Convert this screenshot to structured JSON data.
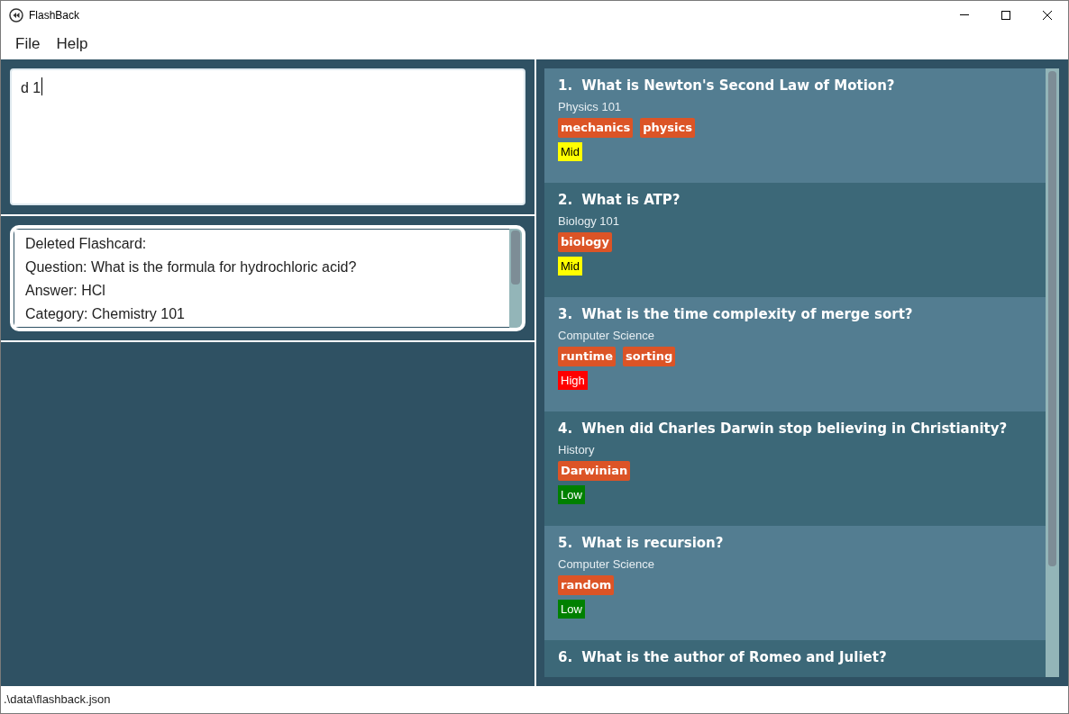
{
  "window": {
    "title": "FlashBack"
  },
  "menu": [
    "File",
    "Help"
  ],
  "command_box": {
    "value": "d 1"
  },
  "result_box": {
    "lines": [
      "Deleted Flashcard:",
      "Question: What is the formula for hydrochloric acid?",
      "Answer: HCl",
      "Category: Chemistry 101"
    ]
  },
  "flashcards": [
    {
      "index": "1.",
      "question": "What is Newton's Second Law of Motion?",
      "category": "Physics 101",
      "tags": [
        "mechanics",
        "physics"
      ],
      "difficulty": {
        "label": "Mid",
        "kind": "mid"
      }
    },
    {
      "index": "2.",
      "question": "What is ATP?",
      "category": "Biology 101",
      "tags": [
        "biology"
      ],
      "difficulty": {
        "label": "Mid",
        "kind": "mid"
      }
    },
    {
      "index": "3.",
      "question": "What is the time complexity of merge sort?",
      "category": "Computer Science",
      "tags": [
        "runtime",
        "sorting"
      ],
      "difficulty": {
        "label": "High",
        "kind": "high"
      }
    },
    {
      "index": "4.",
      "question": "When did Charles Darwin stop believing in Christianity?",
      "category": "History",
      "tags": [
        "Darwinian"
      ],
      "difficulty": {
        "label": "Low",
        "kind": "low"
      }
    },
    {
      "index": "5.",
      "question": "What is recursion?",
      "category": "Computer Science",
      "tags": [
        "random"
      ],
      "difficulty": {
        "label": "Low",
        "kind": "low"
      }
    },
    {
      "index": "6.",
      "question": "What is the author of Romeo and Juliet?"
    }
  ],
  "status_bar": ".\\data\\flashback.json"
}
